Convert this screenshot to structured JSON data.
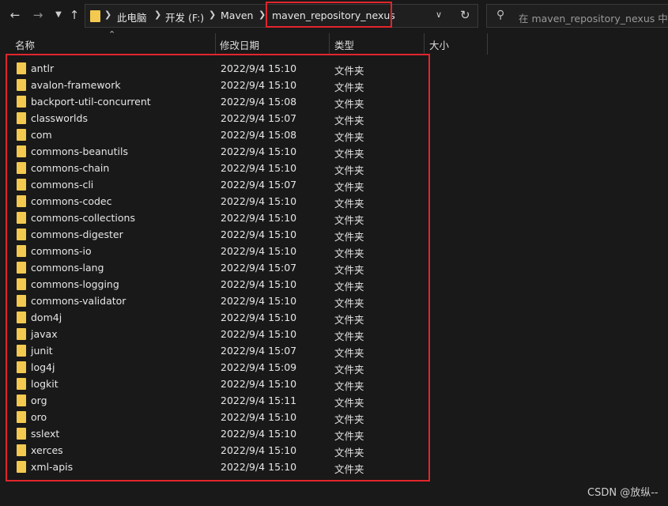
{
  "toolbar": {
    "back_icon": "arrow-left",
    "forward_icon": "arrow-right",
    "history_icon": "chevron-down",
    "up_icon": "arrow-up"
  },
  "address_bar": {
    "crumbs": [
      "此电脑",
      "开发 (F:)",
      "Maven",
      "maven_repository_nexus"
    ],
    "highlight_color": "#e2252b"
  },
  "search": {
    "placeholder": "在 maven_repository_nexus 中搜索"
  },
  "columns": {
    "name": "名称",
    "modified": "修改日期",
    "type": "类型",
    "size": "大小"
  },
  "files": [
    {
      "name": "antlr",
      "modified": "2022/9/4 15:10",
      "type": "文件夹"
    },
    {
      "name": "avalon-framework",
      "modified": "2022/9/4 15:10",
      "type": "文件夹"
    },
    {
      "name": "backport-util-concurrent",
      "modified": "2022/9/4 15:08",
      "type": "文件夹"
    },
    {
      "name": "classworlds",
      "modified": "2022/9/4 15:07",
      "type": "文件夹"
    },
    {
      "name": "com",
      "modified": "2022/9/4 15:08",
      "type": "文件夹"
    },
    {
      "name": "commons-beanutils",
      "modified": "2022/9/4 15:10",
      "type": "文件夹"
    },
    {
      "name": "commons-chain",
      "modified": "2022/9/4 15:10",
      "type": "文件夹"
    },
    {
      "name": "commons-cli",
      "modified": "2022/9/4 15:07",
      "type": "文件夹"
    },
    {
      "name": "commons-codec",
      "modified": "2022/9/4 15:10",
      "type": "文件夹"
    },
    {
      "name": "commons-collections",
      "modified": "2022/9/4 15:10",
      "type": "文件夹"
    },
    {
      "name": "commons-digester",
      "modified": "2022/9/4 15:10",
      "type": "文件夹"
    },
    {
      "name": "commons-io",
      "modified": "2022/9/4 15:10",
      "type": "文件夹"
    },
    {
      "name": "commons-lang",
      "modified": "2022/9/4 15:07",
      "type": "文件夹"
    },
    {
      "name": "commons-logging",
      "modified": "2022/9/4 15:10",
      "type": "文件夹"
    },
    {
      "name": "commons-validator",
      "modified": "2022/9/4 15:10",
      "type": "文件夹"
    },
    {
      "name": "dom4j",
      "modified": "2022/9/4 15:10",
      "type": "文件夹"
    },
    {
      "name": "javax",
      "modified": "2022/9/4 15:10",
      "type": "文件夹"
    },
    {
      "name": "junit",
      "modified": "2022/9/4 15:07",
      "type": "文件夹"
    },
    {
      "name": "log4j",
      "modified": "2022/9/4 15:09",
      "type": "文件夹"
    },
    {
      "name": "logkit",
      "modified": "2022/9/4 15:10",
      "type": "文件夹"
    },
    {
      "name": "org",
      "modified": "2022/9/4 15:11",
      "type": "文件夹"
    },
    {
      "name": "oro",
      "modified": "2022/9/4 15:10",
      "type": "文件夹"
    },
    {
      "name": "sslext",
      "modified": "2022/9/4 15:10",
      "type": "文件夹"
    },
    {
      "name": "xerces",
      "modified": "2022/9/4 15:10",
      "type": "文件夹"
    },
    {
      "name": "xml-apis",
      "modified": "2022/9/4 15:10",
      "type": "文件夹"
    }
  ],
  "folder_icon_color": "#f3c94f",
  "watermark": "CSDN @放纵--"
}
